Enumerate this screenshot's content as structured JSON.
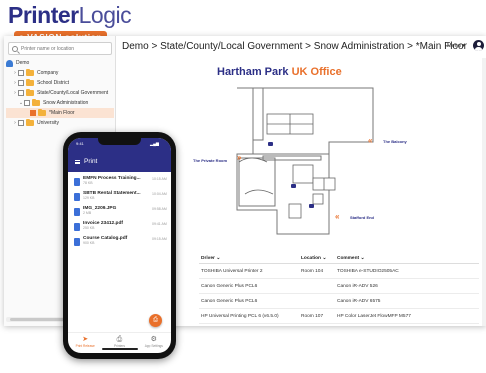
{
  "logo": {
    "main_bold": "Printer",
    "main_light": "Logic",
    "sub": "a VASION solution"
  },
  "sidebar": {
    "search_placeholder": "Printer name or location",
    "tree": [
      {
        "label": "Demo",
        "level": 0,
        "type": "root"
      },
      {
        "label": "Company",
        "level": 1,
        "type": "folder"
      },
      {
        "label": "School District",
        "level": 1,
        "type": "folder"
      },
      {
        "label": "State/County/Local Government",
        "level": 1,
        "type": "folder"
      },
      {
        "label": "Snow Administration",
        "level": 2,
        "type": "folder"
      },
      {
        "label": "*Main Floor",
        "level": 3,
        "type": "folder",
        "selected": true
      },
      {
        "label": "University",
        "level": 1,
        "type": "folder"
      }
    ]
  },
  "header": {
    "breadcrumb": "Demo  >  State/County/Local Government  >  Snow Administration  >  *Main Floor",
    "menu_label": "Menu ▾"
  },
  "office": {
    "title_main": "Hartham Park ",
    "title_highlight": "UK Office",
    "rooms": {
      "left": "The Private Room",
      "right": "The Balcony",
      "lower_right": "Stafford End"
    }
  },
  "table": {
    "headers": [
      "Driver ⌄",
      "Location ⌄",
      "Comment ⌄"
    ],
    "rows": [
      [
        "TOSHIBA Universal Printer 2",
        "Room 104",
        "TOSHIBA e-STUDIO2505AC"
      ],
      [
        "Canon Generic Plus PCL6",
        "",
        "Canon iR-ADV 526"
      ],
      [
        "Canon Generic Plus PCL6",
        "",
        "Canon iR-ADV 6575"
      ],
      [
        "HP Universal Printing PCL 6 (v6.5.0)",
        "Room 107",
        "HP Color LaserJet FlowMFP M577"
      ]
    ]
  },
  "phone": {
    "status_time": "9:41",
    "status_icons": "▂▄▆",
    "title": "Print",
    "documents": [
      {
        "name": "EMFN Process Training...",
        "size": "78 KB",
        "time": "10:15 AM"
      },
      {
        "name": "SBTB Rental Statement...",
        "size": "129 KB",
        "time": "10:04 AM"
      },
      {
        "name": "IMG_2209.JPG",
        "size": "2 MB",
        "time": "09:58 AM"
      },
      {
        "name": "Invoice 23412.pdf",
        "size": "250 KB",
        "time": "09:41 AM"
      },
      {
        "name": "Course Catalog.pdf",
        "size": "900 KB",
        "time": "09:15 AM"
      }
    ],
    "fab": "⎙",
    "nav": [
      {
        "glyph": "➤",
        "label": "Print Release",
        "active": true
      },
      {
        "glyph": "⎙",
        "label": "Printers",
        "active": false
      },
      {
        "glyph": "⚙",
        "label": "App Settings",
        "active": false
      }
    ]
  },
  "colors": {
    "brand_navy": "#2c2f86",
    "accent_orange": "#e9702b",
    "folder_yellow": "#f3b13b",
    "doc_blue": "#3b6fd8"
  }
}
